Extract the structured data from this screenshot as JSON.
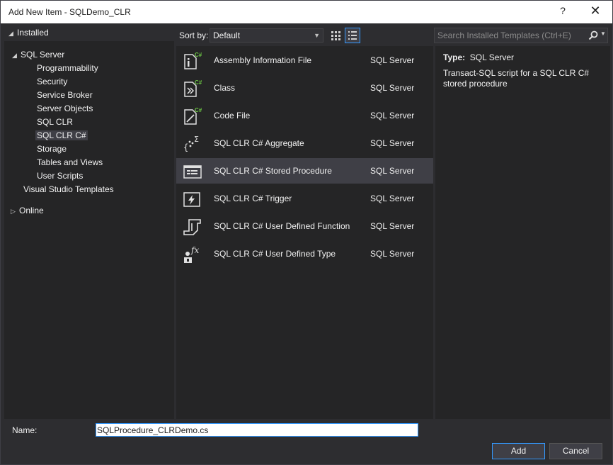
{
  "window": {
    "title": "Add New Item - SQLDemo_CLR",
    "help_label": "?",
    "close_label": "✕"
  },
  "tree": {
    "installed": "Installed",
    "sql_server": "SQL Server",
    "children": [
      "Programmability",
      "Security",
      "Service Broker",
      "Server Objects",
      "SQL CLR",
      "SQL CLR C#",
      "Storage",
      "Tables and Views",
      "User Scripts"
    ],
    "selected": "SQL CLR C#",
    "vs_templates": "Visual Studio Templates",
    "online": "Online"
  },
  "toolbar": {
    "sort_label": "Sort by:",
    "sort_value": "Default",
    "search_placeholder": "Search Installed Templates (Ctrl+E)"
  },
  "templates": [
    {
      "name": "Assembly Information File",
      "type": "SQL Server",
      "icon": "assembly-info-file-icon"
    },
    {
      "name": "Class",
      "type": "SQL Server",
      "icon": "class-file-icon"
    },
    {
      "name": "Code File",
      "type": "SQL Server",
      "icon": "code-file-icon"
    },
    {
      "name": "SQL CLR C# Aggregate",
      "type": "SQL Server",
      "icon": "aggregate-icon"
    },
    {
      "name": "SQL CLR C# Stored Procedure",
      "type": "SQL Server",
      "icon": "stored-procedure-icon"
    },
    {
      "name": "SQL CLR C# Trigger",
      "type": "SQL Server",
      "icon": "trigger-icon"
    },
    {
      "name": "SQL CLR C# User Defined Function",
      "type": "SQL Server",
      "icon": "user-defined-function-icon"
    },
    {
      "name": "SQL CLR C# User Defined Type",
      "type": "SQL Server",
      "icon": "user-defined-type-icon"
    }
  ],
  "selected_template": "SQL CLR C# Stored Procedure",
  "details": {
    "type_label": "Type:",
    "type_value": "SQL Server",
    "description": "Transact-SQL script for a SQL CLR C# stored procedure"
  },
  "footer": {
    "name_label": "Name:",
    "name_value": "SQLProcedure_CLRDemo.cs",
    "add_label": "Add",
    "cancel_label": "Cancel"
  },
  "colors": {
    "background": "#2d2d30",
    "pane": "#252526",
    "selection": "#3f3f46",
    "accent": "#3399ff",
    "csharp_badge": "#6cc644"
  }
}
